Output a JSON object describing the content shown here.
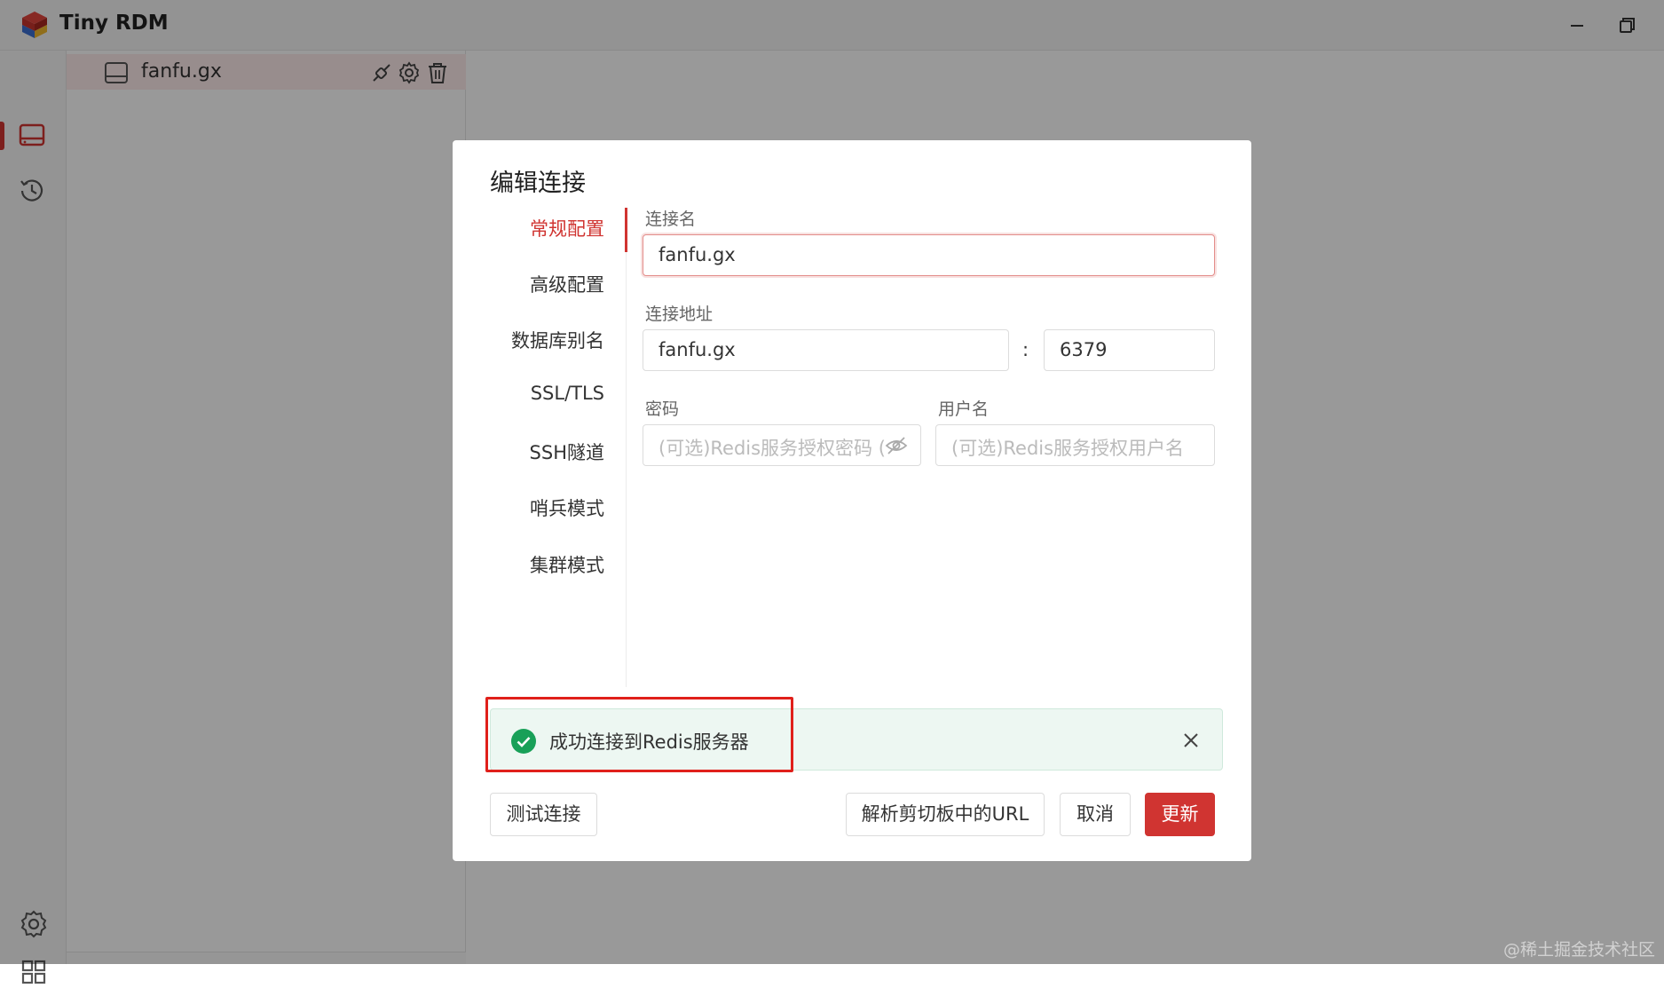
{
  "app": {
    "title": "Tiny RDM",
    "accent_color": "#d03431"
  },
  "window_controls": {
    "minimize_icon": "minimize-icon",
    "restore_icon": "restore-icon"
  },
  "ribbon": {
    "top_items": [
      {
        "icon": "server-icon",
        "active": true
      },
      {
        "icon": "history-icon",
        "active": false
      }
    ],
    "bottom_items": [
      {
        "icon": "gear-icon"
      },
      {
        "icon": "grid-icon"
      }
    ]
  },
  "sidebar": {
    "connections": [
      {
        "name": "fanfu.gx",
        "icon": "server-icon",
        "actions": [
          "connect-icon",
          "gear-icon",
          "trash-icon"
        ]
      }
    ]
  },
  "dialog": {
    "title": "编辑连接",
    "nav": [
      {
        "label": "常规配置",
        "active": true
      },
      {
        "label": "高级配置",
        "active": false
      },
      {
        "label": "数据库别名",
        "active": false
      },
      {
        "label": "SSL/TLS",
        "active": false
      },
      {
        "label": "SSH隧道",
        "active": false
      },
      {
        "label": "哨兵模式",
        "active": false
      },
      {
        "label": "集群模式",
        "active": false
      }
    ],
    "form": {
      "name_label": "连接名",
      "name_value": "fanfu.gx",
      "addr_label": "连接地址",
      "host_value": "fanfu.gx",
      "colon": ":",
      "port_value": "6379",
      "password_label": "密码",
      "password_placeholder": "(可选)Redis服务授权密码 (",
      "username_label": "用户名",
      "username_placeholder": "(可选)Redis服务授权用户名"
    },
    "alert": {
      "text": "成功连接到Redis服务器",
      "status_color": "#18a058"
    },
    "buttons": {
      "test": "测试连接",
      "parse_url": "解析剪切板中的URL",
      "cancel": "取消",
      "update": "更新"
    }
  },
  "watermark": "@稀土掘金技术社区"
}
